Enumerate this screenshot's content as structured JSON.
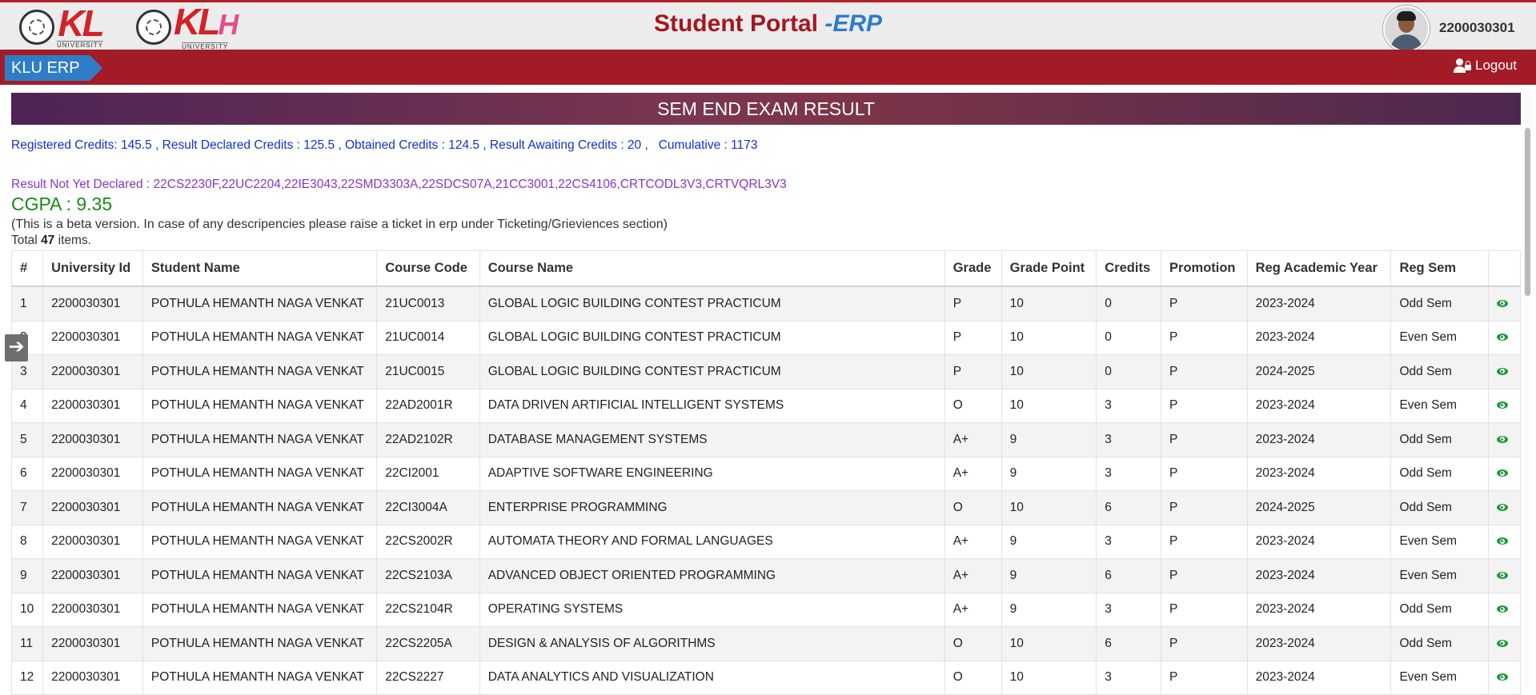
{
  "header": {
    "logo1": {
      "text": "KL",
      "sub": "UNIVERSITY"
    },
    "logo2": {
      "text_k": "KL",
      "text_h": "H",
      "sub": "UNIVERSITY"
    },
    "portal_title": "Student Portal ",
    "portal_title_accent": "-ERP",
    "user_id": "2200030301"
  },
  "nav": {
    "brand": "KLU ERP",
    "logout": "Logout"
  },
  "page": {
    "banner": "SEM END EXAM RESULT",
    "credits_line": "Registered Credits: 145.5 , Result Declared Credits : 125.5 , Obtained Credits : 124.5 , Result Awaiting Credits : 20 ,   Cumulative : 1173",
    "not_declared": "Result Not Yet Declared : 22CS2230F,22UC2204,22IE3043,22SMD3303A,22SDCS07A,21CC3001,22CS4106,CRTCODL3V3,CRTVQRL3V3",
    "cgpa": "CGPA : 9.35",
    "beta_note": "(This is a beta version. In case of any descripencies please raise a ticket in erp under Ticketing/Grieviences section)",
    "total_prefix": "Total ",
    "total_count": "47",
    "total_suffix": " items."
  },
  "table": {
    "columns": [
      "#",
      "University Id",
      "Student Name",
      "Course Code",
      "Course Name",
      "Grade",
      "Grade Point",
      "Credits",
      "Promotion",
      "Reg Academic Year",
      "Reg Sem",
      ""
    ],
    "rows": [
      [
        "1",
        "2200030301",
        "POTHULA HEMANTH NAGA VENKAT",
        "21UC0013",
        "GLOBAL LOGIC BUILDING CONTEST PRACTICUM",
        "P",
        "10",
        "0",
        "P",
        "2023-2024",
        "Odd Sem"
      ],
      [
        "2",
        "2200030301",
        "POTHULA HEMANTH NAGA VENKAT",
        "21UC0014",
        "GLOBAL LOGIC BUILDING CONTEST PRACTICUM",
        "P",
        "10",
        "0",
        "P",
        "2023-2024",
        "Even Sem"
      ],
      [
        "3",
        "2200030301",
        "POTHULA HEMANTH NAGA VENKAT",
        "21UC0015",
        "GLOBAL LOGIC BUILDING CONTEST PRACTICUM",
        "P",
        "10",
        "0",
        "P",
        "2024-2025",
        "Odd Sem"
      ],
      [
        "4",
        "2200030301",
        "POTHULA HEMANTH NAGA VENKAT",
        "22AD2001R",
        "DATA DRIVEN ARTIFICIAL INTELLIGENT SYSTEMS",
        "O",
        "10",
        "3",
        "P",
        "2023-2024",
        "Even Sem"
      ],
      [
        "5",
        "2200030301",
        "POTHULA HEMANTH NAGA VENKAT",
        "22AD2102R",
        "DATABASE MANAGEMENT SYSTEMS",
        "A+",
        "9",
        "3",
        "P",
        "2023-2024",
        "Odd Sem"
      ],
      [
        "6",
        "2200030301",
        "POTHULA HEMANTH NAGA VENKAT",
        "22CI2001",
        "ADAPTIVE SOFTWARE ENGINEERING",
        "A+",
        "9",
        "3",
        "P",
        "2023-2024",
        "Odd Sem"
      ],
      [
        "7",
        "2200030301",
        "POTHULA HEMANTH NAGA VENKAT",
        "22CI3004A",
        "ENTERPRISE PROGRAMMING",
        "O",
        "10",
        "6",
        "P",
        "2024-2025",
        "Odd Sem"
      ],
      [
        "8",
        "2200030301",
        "POTHULA HEMANTH NAGA VENKAT",
        "22CS2002R",
        "AUTOMATA THEORY AND FORMAL LANGUAGES",
        "A+",
        "9",
        "3",
        "P",
        "2023-2024",
        "Even Sem"
      ],
      [
        "9",
        "2200030301",
        "POTHULA HEMANTH NAGA VENKAT",
        "22CS2103A",
        "ADVANCED OBJECT ORIENTED PROGRAMMING",
        "A+",
        "9",
        "6",
        "P",
        "2023-2024",
        "Even Sem"
      ],
      [
        "10",
        "2200030301",
        "POTHULA HEMANTH NAGA VENKAT",
        "22CS2104R",
        "OPERATING SYSTEMS",
        "A+",
        "9",
        "3",
        "P",
        "2023-2024",
        "Odd Sem"
      ],
      [
        "11",
        "2200030301",
        "POTHULA HEMANTH NAGA VENKAT",
        "22CS2205A",
        "DESIGN & ANALYSIS OF ALGORITHMS",
        "O",
        "10",
        "6",
        "P",
        "2023-2024",
        "Odd Sem"
      ],
      [
        "12",
        "2200030301",
        "POTHULA HEMANTH NAGA VENKAT",
        "22CS2227",
        "DATA ANALYTICS AND VISUALIZATION",
        "O",
        "10",
        "3",
        "P",
        "2023-2024",
        "Even Sem"
      ]
    ],
    "row_action_icon": "eye-icon"
  },
  "colors": {
    "brand_red": "#a31b26",
    "brand_blue": "#2f7dc7",
    "credits_text": "#1430d6",
    "not_declared_text": "#8b33c9",
    "cgpa_text": "#198a19",
    "view_icon": "#1d9a3a"
  }
}
